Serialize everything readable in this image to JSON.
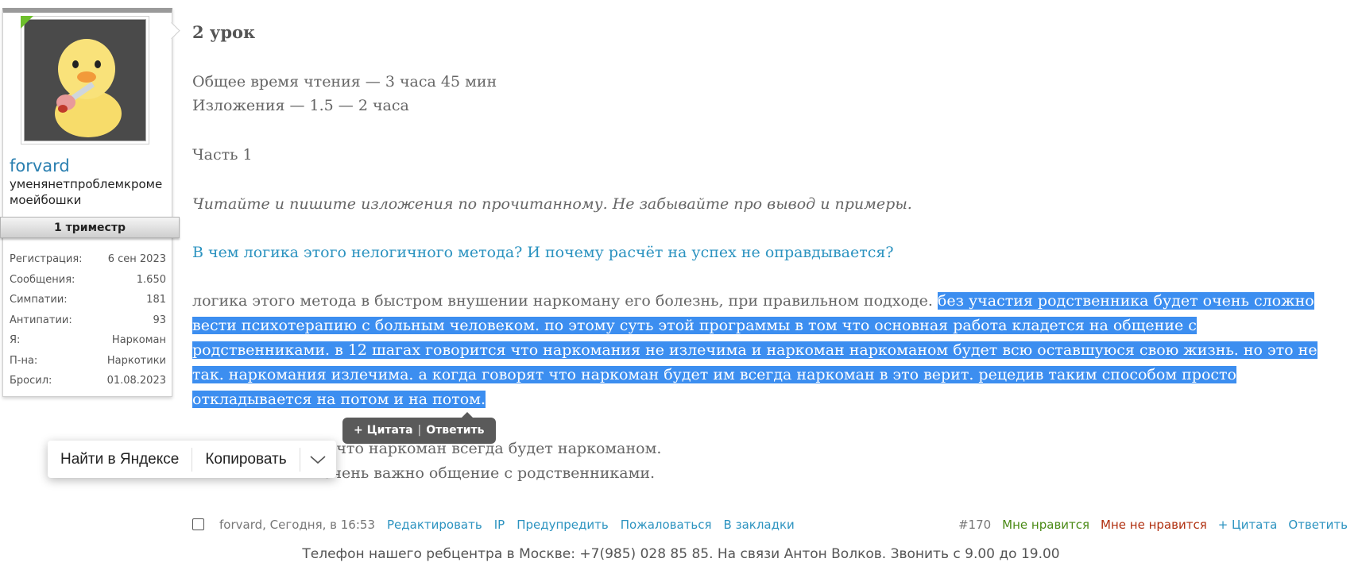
{
  "user": {
    "username": "forvard",
    "status": "уменянетпроблемкроме моейбошки",
    "rank": "1 триместр",
    "stats": [
      {
        "label": "Регистрация:",
        "value": "6 сен 2023"
      },
      {
        "label": "Сообщения:",
        "value": "1.650"
      },
      {
        "label": "Симпатии:",
        "value": "181"
      },
      {
        "label": "Антипатии:",
        "value": "93"
      },
      {
        "label": "Я:",
        "value": "Наркоман"
      },
      {
        "label": "П-на:",
        "value": "Наркотики"
      },
      {
        "label": "Бросил:",
        "value": "01.08.2023"
      }
    ]
  },
  "post": {
    "title": "2 урок",
    "line1": "Общее время чтения — 3 часа 45 мин",
    "line2": "Изложения — 1.5 — 2 часа",
    "line3": "Часть 1",
    "instruction": "Читайте и пишите изложения по прочитанному. Не забывайте про вывод и примеры.",
    "question": "В чем логика этого нелогичного метода? И почему расчёт на успех не оправдывается?",
    "answer_plain": "логика этого метода в быстром внушении наркоману его болезнь, при правильном подходе. ",
    "answer_selected": "без участия родственника будет очень сложно вести психотерапию с больным человеком. по этому суть этой программы в том что основная работа кладется на общение с родственниками. в 12 шагах говорится что наркомания не излечима и наркоман наркоманом будет всю оставшуюся свою жизнь. но это не так. наркомания излечима. а когда говорят что наркоман будет им всегда наркоман в это верит. рецедив таким способом просто откладывается на потом и на потом.",
    "conclusion1": "а что наркоман всегда будет наркоманом.",
    "conclusion2": "очень важно общение с родственниками."
  },
  "quote_popup": {
    "quote": "+ Цитата",
    "separator": "|",
    "reply": "Ответить"
  },
  "yandex_toolbar": {
    "search": "Найти в Яндексе",
    "copy": "Копировать",
    "more_icon": "chevron-down"
  },
  "footer": {
    "author": "forvard, Сегодня, в 16:53",
    "links": [
      "Редактировать",
      "IP",
      "Предупредить",
      "Пожаловаться",
      "В закладки"
    ],
    "post_number": "#170",
    "like": "Мне нравится",
    "dislike": "Мне не нравится",
    "quote": "+ Цитата",
    "reply": "Ответить"
  },
  "signature": "Телефон нашего ребцентра в Москве: +7(985) 028 85 85. На связи Антон Волков. Звонить с 9.00 до 19.00",
  "colors": {
    "link": "#2c93c0",
    "selection": "#3c8ef0",
    "like": "#4a8a15",
    "dislike": "#b03010"
  }
}
